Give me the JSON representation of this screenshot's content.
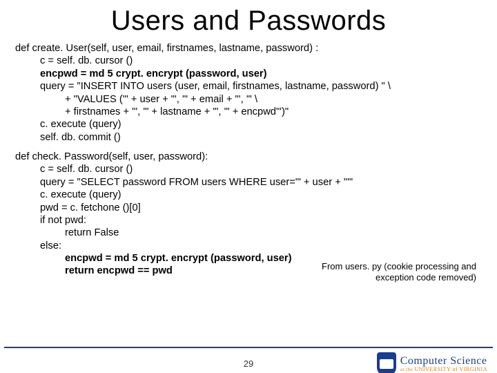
{
  "title": "Users and Passwords",
  "code_block1": [
    {
      "cls": "",
      "text": "def create. User(self, user, email, firstnames, lastname, password) :"
    },
    {
      "cls": "indent1",
      "text": "c = self. db. cursor ()"
    },
    {
      "cls": "indent1 bold",
      "text": "encpwd = md 5 crypt. encrypt (password, user)"
    },
    {
      "cls": "indent1",
      "text": "query = \"INSERT INTO users (user, email, firstnames, lastname, password) \" \\"
    },
    {
      "cls": "indent2",
      "text": "+ \"VALUES ('\" + user + \"', '\" + email + \"', '\" \\"
    },
    {
      "cls": "indent2",
      "text": "+ firstnames + \"', '\" + lastname + \"', '\" + encpwd\"')\""
    },
    {
      "cls": "indent1",
      "text": "c. execute (query)"
    },
    {
      "cls": "indent1",
      "text": "self. db. commit ()"
    }
  ],
  "code_block2": [
    {
      "cls": "",
      "text": "def check. Password(self, user, password):"
    },
    {
      "cls": "indent1",
      "text": "c = self. db. cursor ()"
    },
    {
      "cls": "indent1",
      "text": "query = \"SELECT password FROM users WHERE user='\" + user + \"'\""
    },
    {
      "cls": "indent1",
      "text": "c. execute (query)"
    },
    {
      "cls": "indent1",
      "text": "pwd = c. fetchone ()[0]"
    },
    {
      "cls": "indent1",
      "text": "if not pwd:"
    },
    {
      "cls": "indent2",
      "text": "return False"
    },
    {
      "cls": "indent1",
      "text": "else:"
    },
    {
      "cls": "indent2 bold",
      "text": "encpwd = md 5 crypt. encrypt (password, user)"
    },
    {
      "cls": "indent2 bold",
      "text": "return encpwd == pwd"
    }
  ],
  "annotation": "From users. py (cookie processing and exception code removed)",
  "page_number": "29",
  "logo": {
    "main": "Computer Science",
    "sub_prefix": "at the ",
    "sub_school": "UNIVERSITY of VIRGINIA"
  }
}
